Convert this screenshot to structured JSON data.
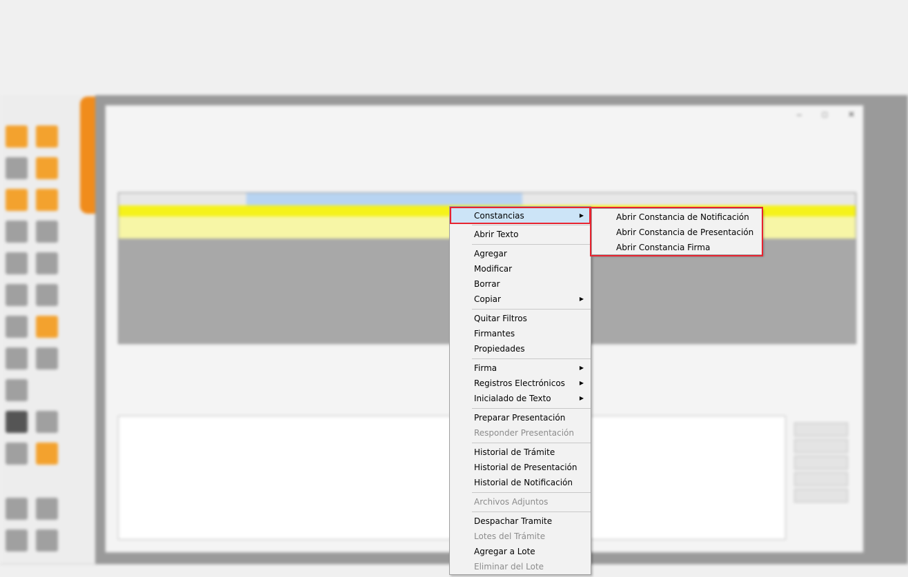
{
  "context_menu": {
    "items": [
      {
        "label": "Constancias",
        "submenu": true
      },
      {
        "label": "Abrir Texto"
      },
      {
        "label": "Agregar"
      },
      {
        "label": "Modificar"
      },
      {
        "label": "Borrar"
      },
      {
        "label": "Copiar",
        "submenu": true
      },
      {
        "label": "Quitar Filtros"
      },
      {
        "label": "Firmantes"
      },
      {
        "label": "Propiedades"
      },
      {
        "label": "Firma",
        "submenu": true
      },
      {
        "label": "Registros Electrónicos",
        "submenu": true
      },
      {
        "label": "Inicialado de Texto",
        "submenu": true
      },
      {
        "label": "Preparar Presentación"
      },
      {
        "label": "Responder Presentación",
        "disabled": true
      },
      {
        "label": "Historial de Trámite"
      },
      {
        "label": "Historial de Presentación"
      },
      {
        "label": "Historial de Notificación"
      },
      {
        "label": "Archivos Adjuntos",
        "disabled": true
      },
      {
        "label": "Despachar Tramite"
      },
      {
        "label": "Lotes del Trámite",
        "disabled": true
      },
      {
        "label": "Agregar a Lote"
      },
      {
        "label": "Eliminar del Lote",
        "disabled": true
      }
    ],
    "submenu_arrow": "▶"
  },
  "constancias_submenu": {
    "items": [
      {
        "label": "Abrir Constancia de Notificación"
      },
      {
        "label": "Abrir Constancia de Presentación"
      },
      {
        "label": "Abrir Constancia Firma"
      }
    ]
  },
  "colors": {
    "highlight": "#cce4f7",
    "annotation_red": "#e8232f",
    "disabled_text": "#8c8c8c"
  }
}
